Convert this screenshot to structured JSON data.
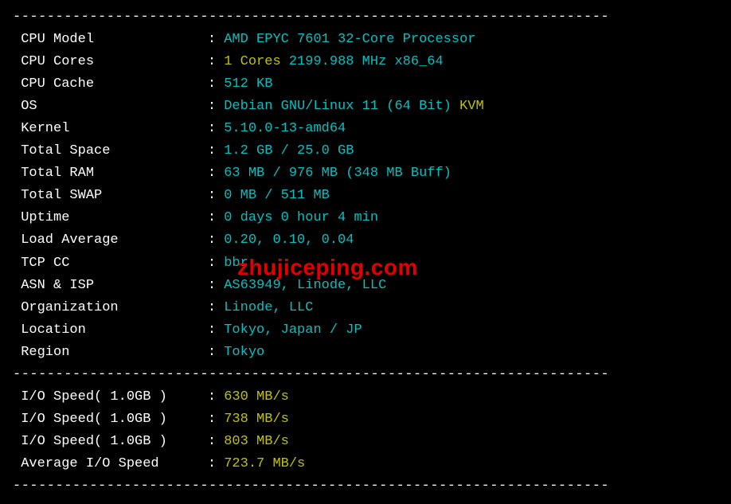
{
  "divider": "----------------------------------------------------------------------",
  "rows": {
    "cpu_model": {
      "label": "CPU Model",
      "value": "AMD EPYC 7601 32-Core Processor"
    },
    "cpu_cores": {
      "label": "CPU Cores",
      "count": "1 Cores",
      "freq": "2199.988 MHz x86_64"
    },
    "cpu_cache": {
      "label": "CPU Cache",
      "value": "512 KB"
    },
    "os": {
      "label": "OS",
      "value": "Debian GNU/Linux 11 (64 Bit)",
      "virt": "KVM"
    },
    "kernel": {
      "label": "Kernel",
      "value": "5.10.0-13-amd64"
    },
    "total_space": {
      "label": "Total Space",
      "value": "1.2 GB / 25.0 GB"
    },
    "total_ram": {
      "label": "Total RAM",
      "value": "63 MB / 976 MB (348 MB Buff)"
    },
    "total_swap": {
      "label": "Total SWAP",
      "value": "0 MB / 511 MB"
    },
    "uptime": {
      "label": "Uptime",
      "value": "0 days 0 hour 4 min"
    },
    "load_avg": {
      "label": "Load Average",
      "value": "0.20, 0.10, 0.04"
    },
    "tcp_cc": {
      "label": "TCP CC",
      "value": "bbr"
    },
    "asn_isp": {
      "label": "ASN & ISP",
      "value": "AS63949, Linode, LLC"
    },
    "organization": {
      "label": "Organization",
      "value": "Linode, LLC"
    },
    "location": {
      "label": "Location",
      "value": "Tokyo, Japan / JP"
    },
    "region": {
      "label": "Region",
      "value": "Tokyo"
    }
  },
  "io": {
    "label": "I/O Speed( 1.0GB )",
    "speed1": "630 MB/s",
    "speed2": "738 MB/s",
    "speed3": "803 MB/s",
    "avg_label": "Average I/O Speed",
    "avg": "723.7 MB/s"
  },
  "watermark": "zhujiceping.com"
}
